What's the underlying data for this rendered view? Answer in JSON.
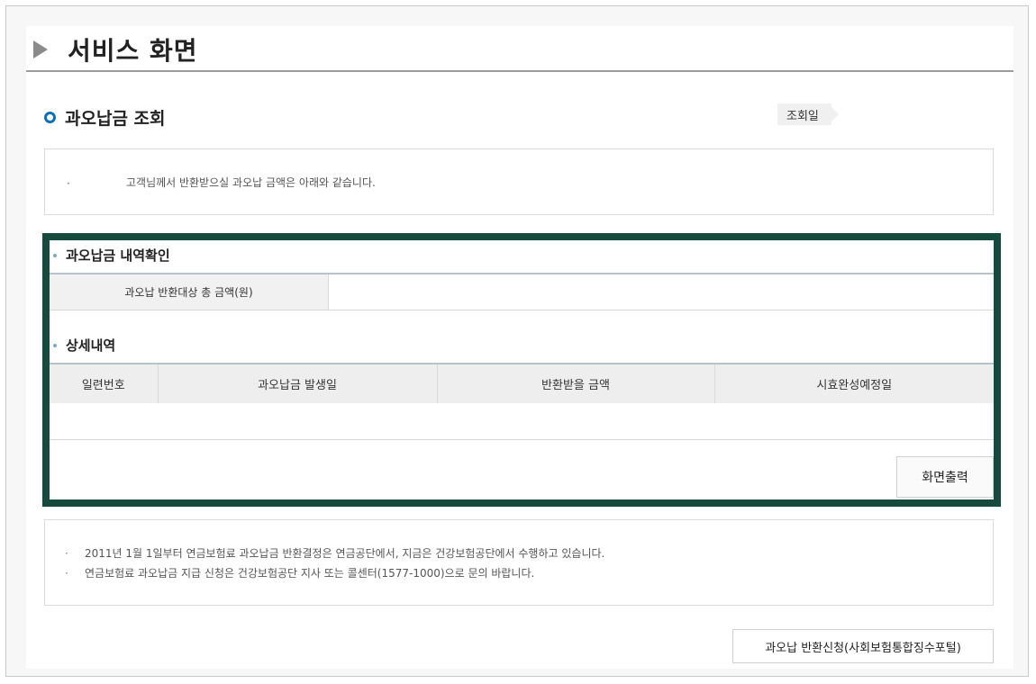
{
  "page": {
    "title": "서비스 화면"
  },
  "section": {
    "title": "과오납금 조회",
    "date_label": "조회일"
  },
  "notice": {
    "bullet": "·",
    "message": "고객님께서 반환받으실 과오납 금액은 아래와 같습니다."
  },
  "summary": {
    "heading": "과오납금 내역확인",
    "total_label": "과오납 반환대상 총 금액(원)",
    "total_value": ""
  },
  "details": {
    "heading": "상세내역",
    "columns": [
      "일련번호",
      "과오납금 발생일",
      "반환받을 금액",
      "시효완성예정일"
    ]
  },
  "buttons": {
    "print": "화면출력",
    "apply": "과오납 반환신청(사회보험통합징수포털)"
  },
  "info": {
    "items": [
      "2011년 1월 1일부터 연금보험료 과오납금 반환결정은 연금공단에서, 지금은 건강보험공단에서 수행하고 있습니다.",
      "연금보험료 과오납금 지급 신청은 건강보험공단 지사 또는 콜센터(1577-1000)으로 문의 바랍니다."
    ]
  },
  "colors": {
    "highlight_border": "#174a3f",
    "ring_icon": "#0b6fb3",
    "table_header_line": "#b6c3cf"
  }
}
